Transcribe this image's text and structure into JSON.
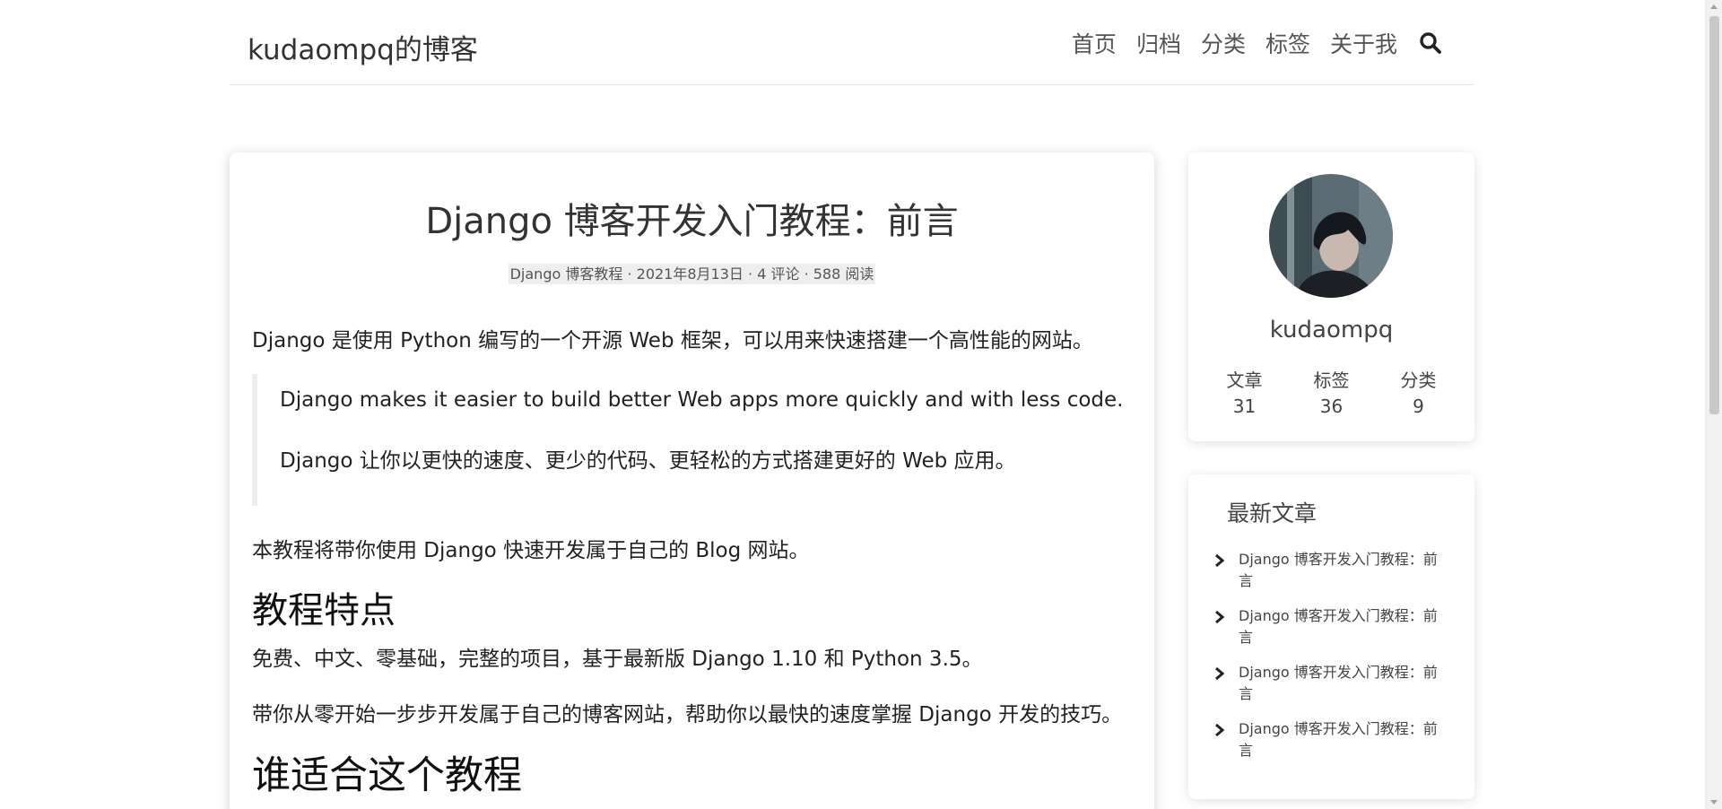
{
  "header": {
    "site_title": "kudaompq的博客",
    "nav": [
      "首页",
      "归档",
      "分类",
      "标签",
      "关于我"
    ]
  },
  "article": {
    "title": "Django 博客开发入门教程：前言",
    "meta": {
      "category": "Django 博客教程",
      "date": "2021年8月13日",
      "comments": "4 评论",
      "views": "588 阅读",
      "sep": "·"
    },
    "intro": "Django 是使用 Python 编写的一个开源 Web 框架，可以用来快速搭建一个高性能的网站。",
    "quote_en": "Django makes it easier to build better Web apps more quickly and with less code.",
    "quote_zh": "Django 让你以更快的速度、更少的代码、更轻松的方式搭建更好的 Web 应用。",
    "p2": "本教程将带你使用 Django 快速开发属于自己的 Blog 网站。",
    "h2_features": "教程特点",
    "p3": "免费、中文、零基础，完整的项目，基于最新版 Django 1.10 和 Python 3.5。",
    "p4": "带你从零开始一步步开发属于自己的博客网站，帮助你以最快的速度掌握 Django 开发的技巧。",
    "h1_audience": "谁适合这个教程"
  },
  "profile": {
    "name": "kudaompq",
    "stats": [
      {
        "label": "文章",
        "value": "31"
      },
      {
        "label": "标签",
        "value": "36"
      },
      {
        "label": "分类",
        "value": "9"
      }
    ]
  },
  "recent": {
    "title": "最新文章",
    "items": [
      "Django 博客开发入门教程：前言",
      "Django 博客开发入门教程：前言",
      "Django 博客开发入门教程：前言",
      "Django 博客开发入门教程：前言"
    ]
  },
  "colors": {
    "text": "#222222",
    "muted": "#555555",
    "meta_bg": "#eeeeee",
    "quote_border": "#eeeeee"
  }
}
